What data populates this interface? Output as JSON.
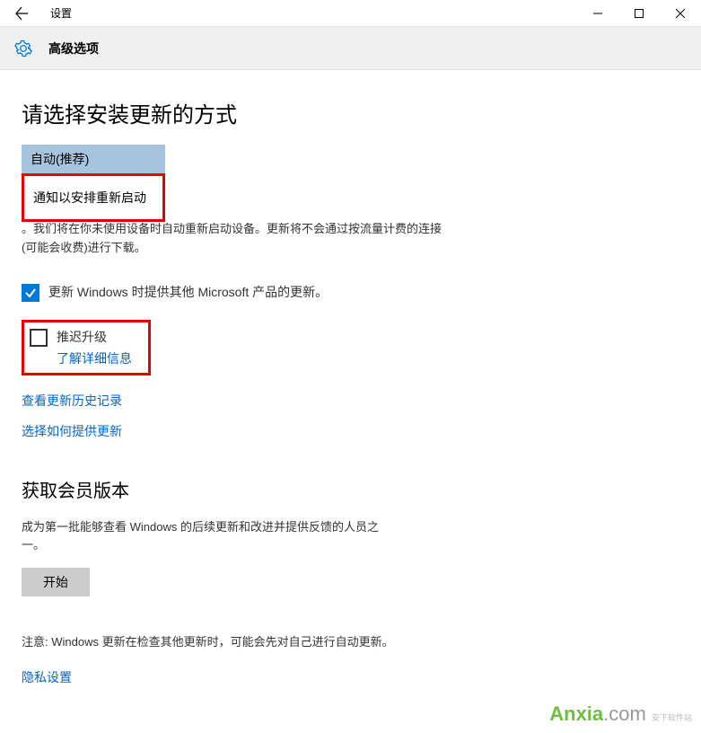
{
  "titlebar": {
    "title": "设置"
  },
  "header": {
    "title": "高级选项"
  },
  "main": {
    "heading": "请选择安装更新的方式",
    "dropdown": {
      "selected": "自动(推荐)",
      "option": "通知以安排重新启动"
    },
    "description": "。我们将在你未使用设备时自动重新启动设备。更新将不会通过按流量计费的连接(可能会收费)进行下载。",
    "checkbox_other_products": "更新 Windows 时提供其他 Microsoft 产品的更新。",
    "defer": {
      "label": "推迟升级",
      "link": "了解详细信息"
    },
    "link_history": "查看更新历史记录",
    "link_delivery": "选择如何提供更新"
  },
  "insider": {
    "heading": "获取会员版本",
    "description": "成为第一批能够查看 Windows 的后续更新和改进并提供反馈的人员之一。",
    "button": "开始",
    "note": "注意: Windows 更新在检查其他更新时，可能会先对自己进行自动更新。",
    "privacy_link": "隐私设置"
  },
  "watermark": {
    "brand1": "Anxia",
    "brand2": ".com",
    "sub": "安下软件站"
  }
}
